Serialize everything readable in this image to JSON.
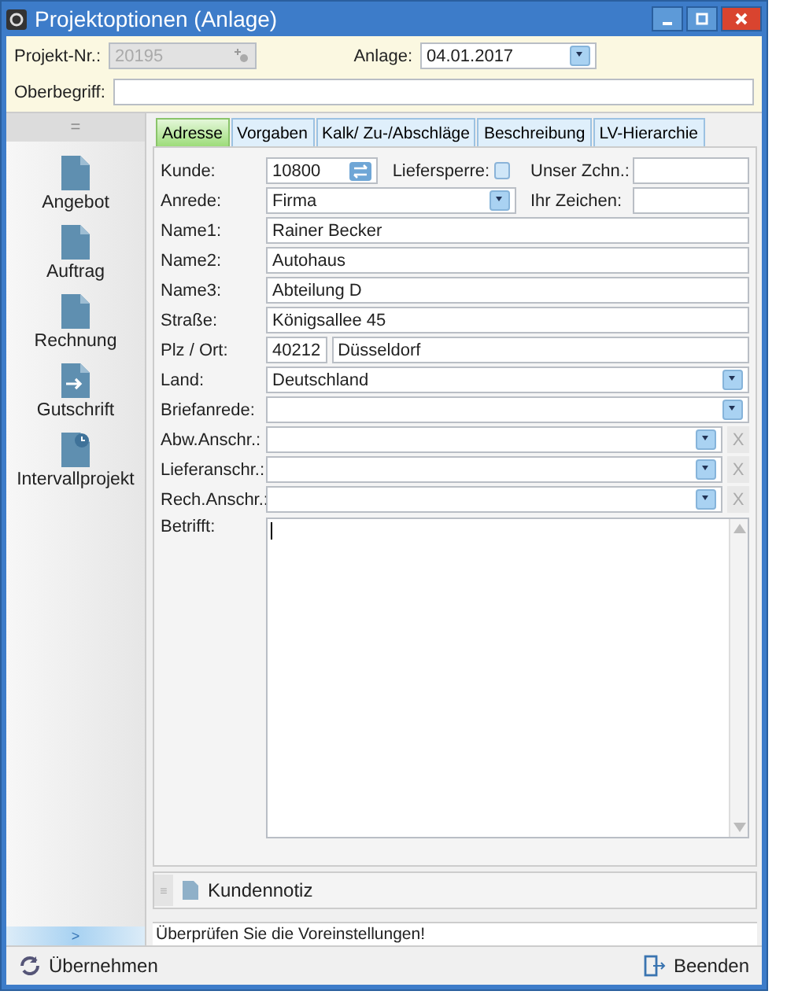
{
  "window": {
    "title": "Projektoptionen (Anlage)"
  },
  "header": {
    "project_label": "Projekt-Nr.:",
    "project_value": "20195",
    "project_disabled": true,
    "date_label": "Anlage:",
    "date_value": "04.01.2017",
    "oberbegriff_label": "Oberbegriff:"
  },
  "sidebar": {
    "collapse": "=",
    "expand": ">",
    "items": [
      {
        "label": "Angebot",
        "kind": "document"
      },
      {
        "label": "Auftrag",
        "kind": "document"
      },
      {
        "label": "Rechnung",
        "kind": "document"
      },
      {
        "label": "Gutschrift",
        "kind": "transfer"
      },
      {
        "label": "Intervallprojekt",
        "kind": "interval"
      }
    ]
  },
  "tabs": [
    {
      "label": "Adresse",
      "selected": true
    },
    {
      "label": "Vorgaben",
      "selected": false
    },
    {
      "label": "Kalk/ Zu-/Abschläge",
      "selected": false
    },
    {
      "label": "Beschreibung",
      "selected": false
    },
    {
      "label": "LV-Hierarchie",
      "selected": false
    }
  ],
  "form": {
    "rows": [
      {
        "label": "Kunde:",
        "kind": "customer",
        "value": "10800"
      },
      {
        "label": "Anrede:",
        "kind": "combo",
        "value": "Firma"
      },
      {
        "label": "Name1:",
        "kind": "text",
        "value": "Rainer Becker"
      },
      {
        "label": "Name2:",
        "kind": "text",
        "value": "Autohaus"
      },
      {
        "label": "Name3:",
        "kind": "text",
        "value": "Abteilung D"
      },
      {
        "label": "Straße:",
        "kind": "text",
        "value": "Königsallee 45"
      },
      {
        "label": "Plz / Ort:",
        "kind": "plz",
        "value": "40212",
        "value2": "Düsseldorf"
      },
      {
        "label": "Land:",
        "kind": "combo",
        "value": "Deutschland"
      },
      {
        "label": "Briefanrede:",
        "kind": "combo"
      },
      {
        "label": "Abw.Anschr.:",
        "kind": "combo_clear",
        "clear": "X"
      },
      {
        "label": "Lieferanschr.:",
        "kind": "combo_clear",
        "clear": "X"
      },
      {
        "label": "Rech.Anschr.:",
        "kind": "combo_clear",
        "clear": "X"
      }
    ],
    "liefersperre": {
      "label": "Liefersperre:",
      "checked": false
    },
    "unser_zeichen_label": "Unser Zchn.:",
    "ihr_zeichen_label": "Ihr Zeichen:",
    "betrifft_label": "Betrifft:"
  },
  "note_bar": {
    "handle": "≡",
    "label": "Kundennotiz"
  },
  "status_bar": "Überprüfen Sie die Voreinstellungen!",
  "buttons": [
    {
      "label": "Übernehmen",
      "kind": "apply"
    },
    {
      "label": "Beenden",
      "kind": "exit"
    }
  ]
}
